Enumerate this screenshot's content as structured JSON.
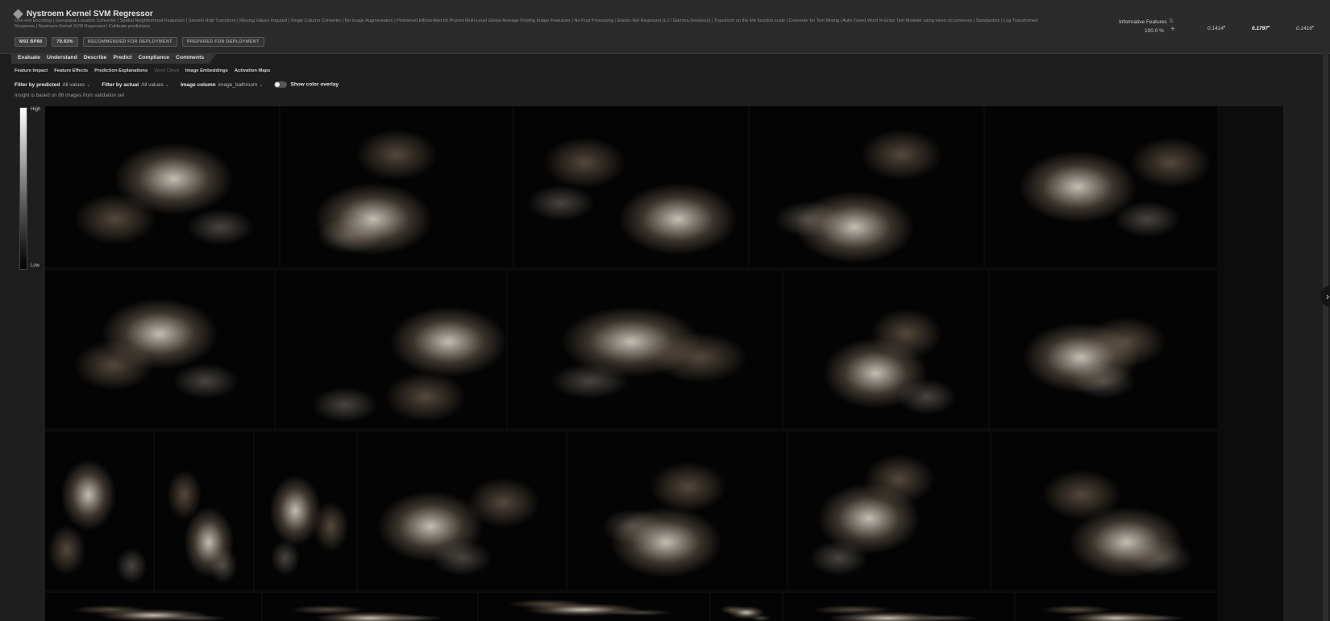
{
  "header": {
    "title": "Nystroem Kernel SVM Regressor",
    "blueprint": "One-Hot Encoding | Geospatial Location Converter | Spatial Neighborhood Featurizer | Smooth Ridit Transform | Missing Values Imputed | Single Column Converter | No Image Augmentation | Pretrained EfficientNet b0 Pruned Multi-Level Global Average Pooling Image Featurizer | No Post Processing | Elastic-Net Regressor (L2 / Gamma Deviance) | Transform on the link function scale | Converter for Text Mining | Auto-Tuned Word N-Gram Text Modeler using token occurrences | Standardize | Log Transformed Response | Nystroem Kernel SVM Regressor | Calibrate predictions",
    "badges": {
      "blueprint_id": "M92 BP88",
      "metric": "79.93%",
      "recommended": "RECOMMENDED FOR DEPLOYMENT",
      "prepared": "PREPARED FOR DEPLOYMENT"
    },
    "informative_features": "Informative Features",
    "informative_pct": "100.0 %",
    "scores": [
      "0.1414",
      "0.1797",
      "0.1416"
    ]
  },
  "tabs": {
    "main": [
      "Evaluate",
      "Understand",
      "Describe",
      "Predict",
      "Compliance",
      "Comments"
    ],
    "sub": [
      "Feature Impact",
      "Feature Effects",
      "Prediction Explanations",
      "Word Cloud",
      "Image Embeddings",
      "Activation Maps"
    ]
  },
  "filters": {
    "predicted_label": "Filter by predicted",
    "predicted_value": "All values",
    "actual_label": "Filter by actual",
    "actual_value": "All values",
    "column_label": "Image column",
    "column_value": "image_bathroom",
    "overlay_label": "Show color overlay"
  },
  "insight_note": "Insight is based on 86 images from validation set",
  "legend": {
    "high": "High",
    "low": "Low"
  },
  "icons": {
    "model": "diamond-icon",
    "add": "plus-icon",
    "sort": "sort-icon",
    "scroll": "chevron-right-icon"
  }
}
